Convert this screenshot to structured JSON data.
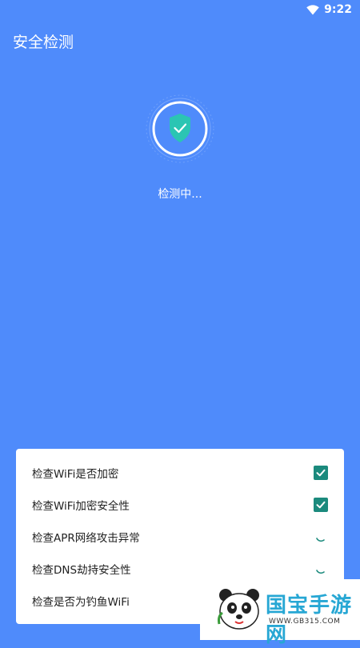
{
  "status_bar": {
    "time": "9:22",
    "wifi_icon": "wifi-icon"
  },
  "app_bar": {
    "title": "安全检测"
  },
  "scanner": {
    "icon": "shield-check-icon",
    "status_text": "检测中..."
  },
  "checks": [
    {
      "label": "检查WiFi是否加密",
      "state": "done"
    },
    {
      "label": "检查WiFi加密安全性",
      "state": "done"
    },
    {
      "label": "检查APR网络攻击异常",
      "state": "loading"
    },
    {
      "label": "检查DNS劫持安全性",
      "state": "loading"
    },
    {
      "label": "检查是否为钓鱼WiFi",
      "state": "loading"
    }
  ],
  "watermark": {
    "text": "国宝手游网",
    "url": "WWW.GB315.COM"
  },
  "colors": {
    "background": "#4f8bfb",
    "check_green": "#1b8a7d",
    "shield": "#2bc5b3"
  }
}
